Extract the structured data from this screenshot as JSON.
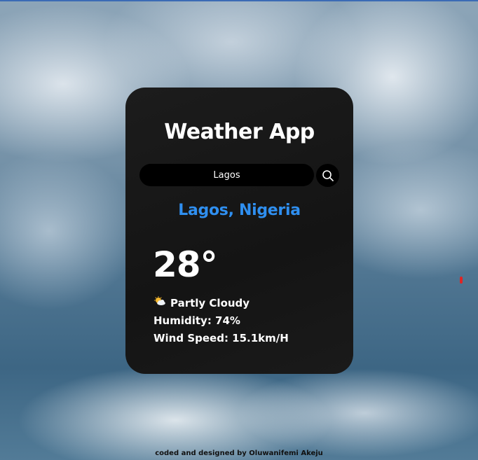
{
  "app": {
    "title": "Weather App"
  },
  "search": {
    "value": "Lagos",
    "button_icon": "search-icon"
  },
  "weather": {
    "location": "Lagos, Nigeria",
    "temperature": "28°",
    "condition_icon": "partly-cloudy-icon",
    "condition": "Partly Cloudy",
    "humidity": "Humidity: 74%",
    "wind_speed": "Wind Speed: 15.1km/H"
  },
  "footer": {
    "credit": "coded and designed by Oluwanifemi Akeju"
  },
  "colors": {
    "card_background": "#141414",
    "location_accent": "#2f8ff0",
    "text": "#ffffff"
  }
}
